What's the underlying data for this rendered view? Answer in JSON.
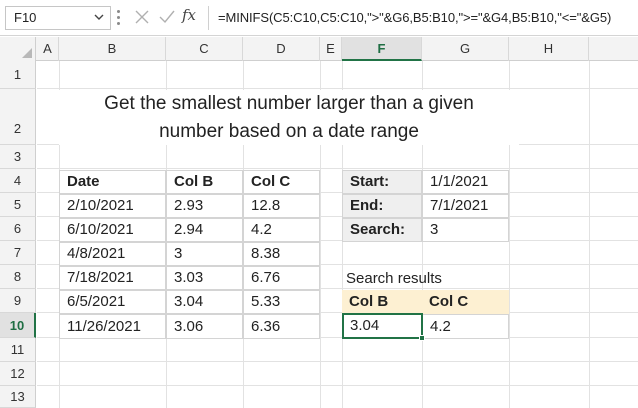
{
  "formula_bar": {
    "name_box": "F10",
    "fx_label": "fx",
    "formula": "=MINIFS(C5:C10,C5:C10,\">\"&G6,B5:B10,\">=\"&G4,B5:B10,\"<=\"&G5)"
  },
  "columns": [
    "A",
    "B",
    "C",
    "D",
    "E",
    "F",
    "G",
    "H"
  ],
  "rows": [
    "1",
    "2",
    "3",
    "4",
    "5",
    "6",
    "7",
    "8",
    "9",
    "10",
    "11",
    "12",
    "13"
  ],
  "title_line1": "Get the smallest number larger than a given",
  "title_line2": "number based on a date range",
  "data_table": {
    "headers": [
      "Date",
      "Col B",
      "Col C"
    ],
    "rows": [
      [
        "2/10/2021",
        "2.93",
        "12.8"
      ],
      [
        "6/10/2021",
        "2.94",
        "4.2"
      ],
      [
        "4/8/2021",
        "3",
        "8.38"
      ],
      [
        "7/18/2021",
        "3.03",
        "6.76"
      ],
      [
        "6/5/2021",
        "3.04",
        "5.33"
      ],
      [
        "11/26/2021",
        "3.06",
        "6.36"
      ]
    ]
  },
  "criteria": [
    {
      "label": "Start:",
      "value": "1/1/2021"
    },
    {
      "label": "End:",
      "value": "7/1/2021"
    },
    {
      "label": "Search:",
      "value": "3"
    }
  ],
  "results": {
    "caption": "Search results",
    "headers": [
      "Col B",
      "Col C"
    ],
    "values": [
      "3.04",
      "4.2"
    ]
  },
  "colors": {
    "selection_green": "#217346",
    "table_header_blue": "#dce9f5",
    "result_header_yellow": "#fdf0d2",
    "label_gray": "#efefef"
  }
}
